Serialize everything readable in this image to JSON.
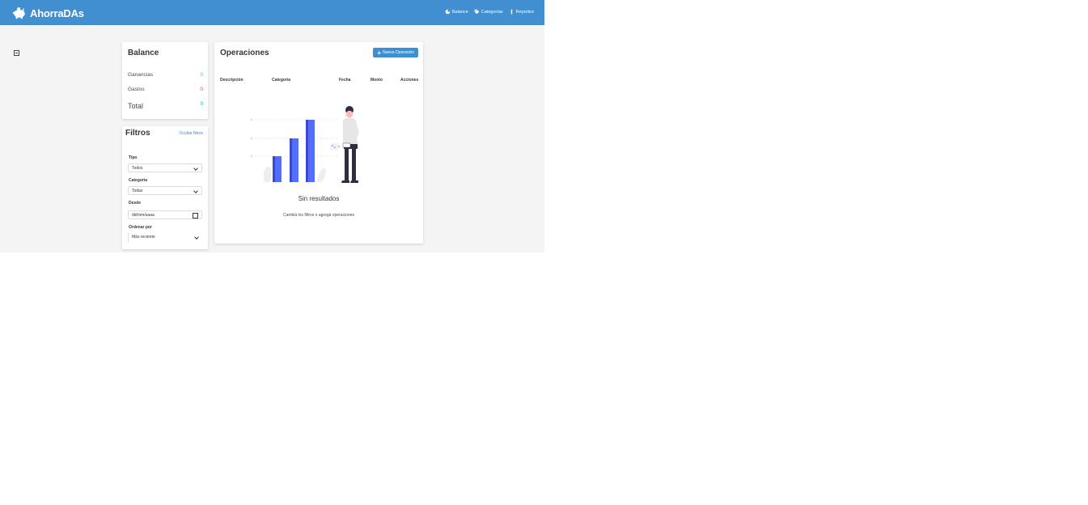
{
  "navbar": {
    "brand": "AhorraDAs",
    "links": [
      {
        "label": "Balance",
        "icon": "chart-pie-icon"
      },
      {
        "label": "Categorías",
        "icon": "tag-icon"
      },
      {
        "label": "Reportes",
        "icon": "chart-bar-icon"
      }
    ]
  },
  "balance": {
    "title": "Balance",
    "rows": [
      {
        "label": "Ganancias",
        "value": "0",
        "color": "#48c78e"
      },
      {
        "label": "Gastos",
        "value": "0",
        "color": "#f14668"
      },
      {
        "label": "Total",
        "value": "0",
        "color": "#00b0b3"
      }
    ]
  },
  "filters": {
    "title": "Filtros",
    "hide_link": "Ocultar filtros",
    "type_label": "Tipo",
    "type_value": "Todos",
    "category_label": "Categoría",
    "category_value": "Todas",
    "since_label": "Desde",
    "since_value": "dd/mm/aaaa",
    "order_label": "Ordenar por",
    "order_value": "Más reciente"
  },
  "operations": {
    "title": "Operaciones",
    "new_button": "Nueva Operación",
    "columns": [
      "Descripción",
      "Categoría",
      "Fecha",
      "Monto",
      "Acciones"
    ],
    "empty_title": "Sin resultados",
    "empty_subtitle": "Cambiá los filtros o agregá operaciones"
  },
  "colors": {
    "navbar": "#418fd0",
    "primary": "#3e8ed0",
    "bars": "#536dfe",
    "background": "#f4f4f4"
  }
}
